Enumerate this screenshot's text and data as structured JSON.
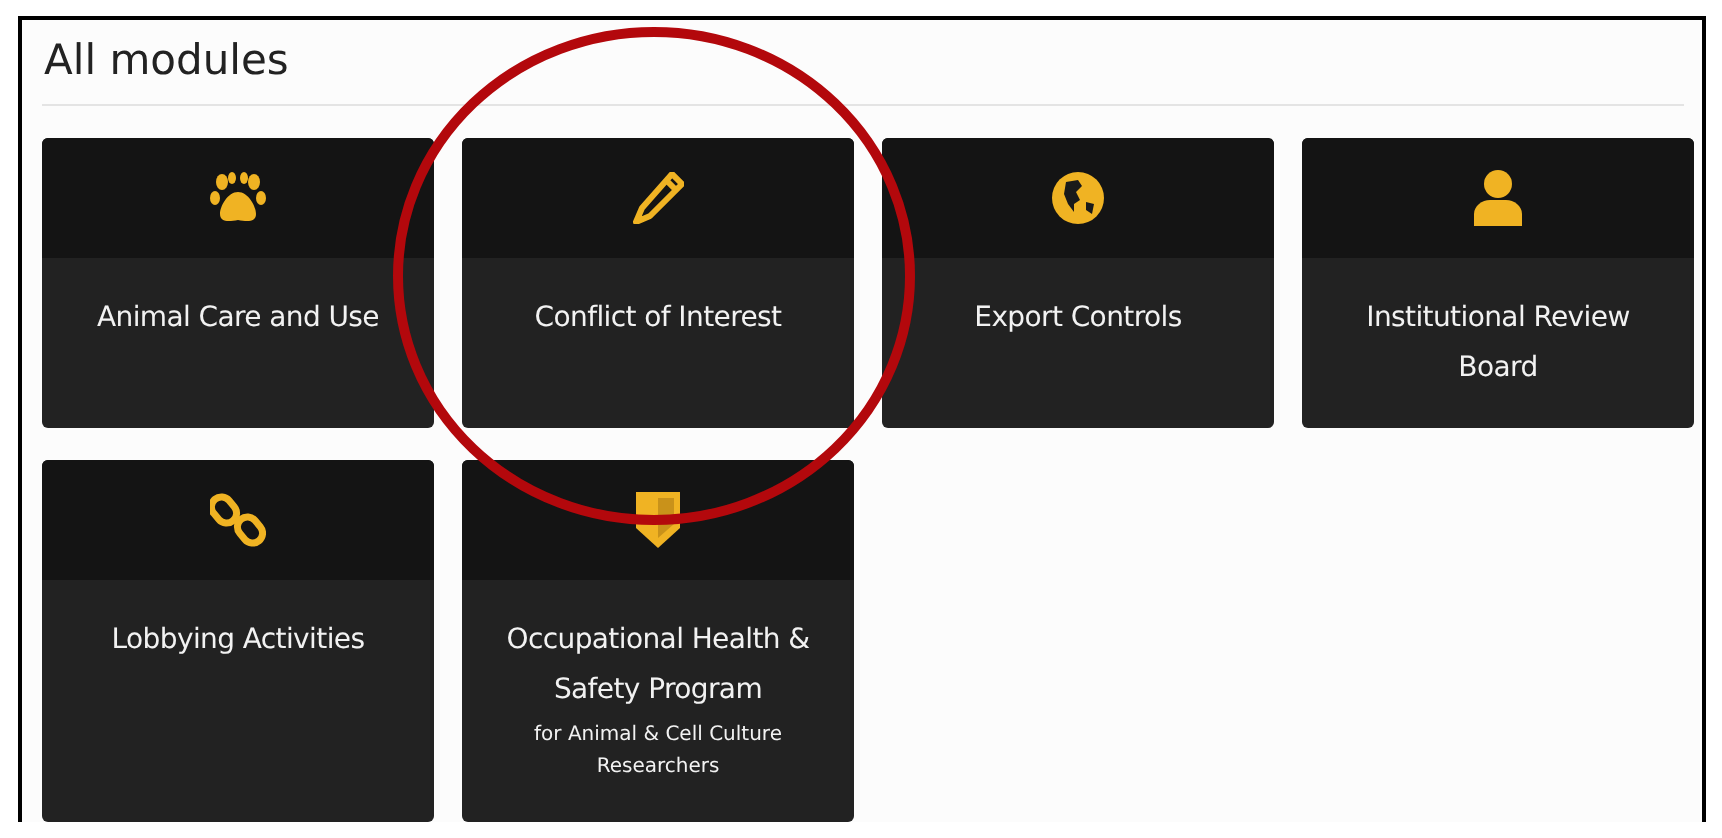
{
  "heading": "All modules",
  "modules": [
    {
      "kind": "paw",
      "title": "Animal Care and Use",
      "highlighted": false
    },
    {
      "kind": "pencil",
      "title": "Conflict of Interest",
      "highlighted": true
    },
    {
      "kind": "globe",
      "title": "Export Controls",
      "highlighted": false
    },
    {
      "kind": "person",
      "title": "Institutional Review Board",
      "highlighted": false
    },
    {
      "kind": "chain",
      "title": "Lobbying Activities",
      "highlighted": false
    },
    {
      "kind": "shield",
      "title": "Occupational Health & Safety Program",
      "subtitle": "for Animal & Cell Culture Researchers",
      "highlighted": false
    }
  ]
}
